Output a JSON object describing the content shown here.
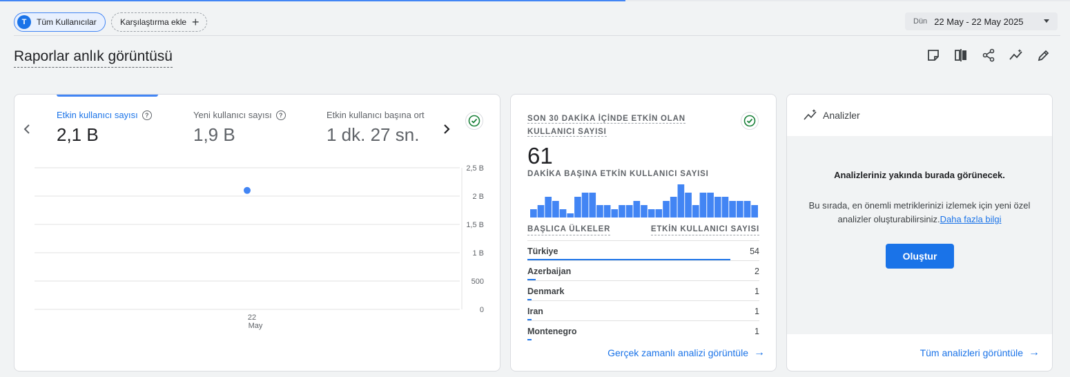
{
  "filter_bar": {
    "segment_avatar": "T",
    "segment_label": "Tüm Kullanıcılar",
    "compare_label": "Karşılaştırma ekle",
    "date_prefix": "Dün",
    "date_range": "22 May - 22 May 2025"
  },
  "page": {
    "title": "Raporlar anlık görüntüsü",
    "toolbar_icons": [
      "note-icon",
      "compare-icon",
      "share-icon",
      "insights-icon",
      "edit-icon"
    ]
  },
  "metrics_card": {
    "metrics": [
      {
        "label": "Etkin kullanıcı sayısı",
        "value": "2,1 B",
        "selected": true
      },
      {
        "label": "Yeni kullanıcı sayısı",
        "value": "1,9 B",
        "selected": false
      },
      {
        "label": "Etkin kullanıcı başına ort",
        "value": "1 dk. 27 sn.",
        "selected": false
      }
    ],
    "chart_data": {
      "type": "scatter",
      "x_tick_day": "22",
      "x_tick_month": "May",
      "y_ticks": [
        "2,5 B",
        "2 B",
        "1,5 B",
        "1 B",
        "500",
        "0"
      ],
      "ylim": [
        0,
        2500
      ],
      "points": [
        {
          "x": "22 May",
          "y": 2100
        }
      ]
    }
  },
  "realtime_card": {
    "title": "SON 30 DAKİKA İÇİNDE ETKİN OLAN KULLANICI SAYISI",
    "count": "61",
    "per_minute_label": "DAKİKA BAŞINA ETKİN KULLANICI SAYISI",
    "chart_data": {
      "type": "bar",
      "values": [
        2,
        3,
        5,
        4,
        2,
        1,
        5,
        6,
        6,
        3,
        3,
        2,
        3,
        3,
        4,
        3,
        2,
        2,
        4,
        5,
        8,
        6,
        3,
        6,
        6,
        5,
        5,
        4,
        4,
        4,
        3
      ],
      "ylim": [
        0,
        8
      ]
    },
    "countries_header": "BAŞLICA ÜLKELER",
    "users_header": "ETKİN KULLANICI SAYISI",
    "countries": [
      {
        "name": "Türkiye",
        "value": "54",
        "share": 1.0
      },
      {
        "name": "Azerbaijan",
        "value": "2",
        "share": 0.04
      },
      {
        "name": "Denmark",
        "value": "1",
        "share": 0.02
      },
      {
        "name": "Iran",
        "value": "1",
        "share": 0.02
      },
      {
        "name": "Montenegro",
        "value": "1",
        "share": 0.02
      }
    ],
    "link": "Gerçek zamanlı analizi görüntüle"
  },
  "insights_card": {
    "title": "Analizler",
    "heading": "Analizleriniz yakında burada görünecek.",
    "text": "Bu sırada, en önemli metriklerinizi izlemek için yeni özel analizler oluşturabilirsiniz.",
    "learn_more": "Daha fazla bilgi",
    "create_button": "Oluştur",
    "link": "Tüm analizleri görüntüle"
  },
  "colors": {
    "accent": "#1a73e8",
    "chart_blue": "#4285f4",
    "check_green": "#188038"
  }
}
